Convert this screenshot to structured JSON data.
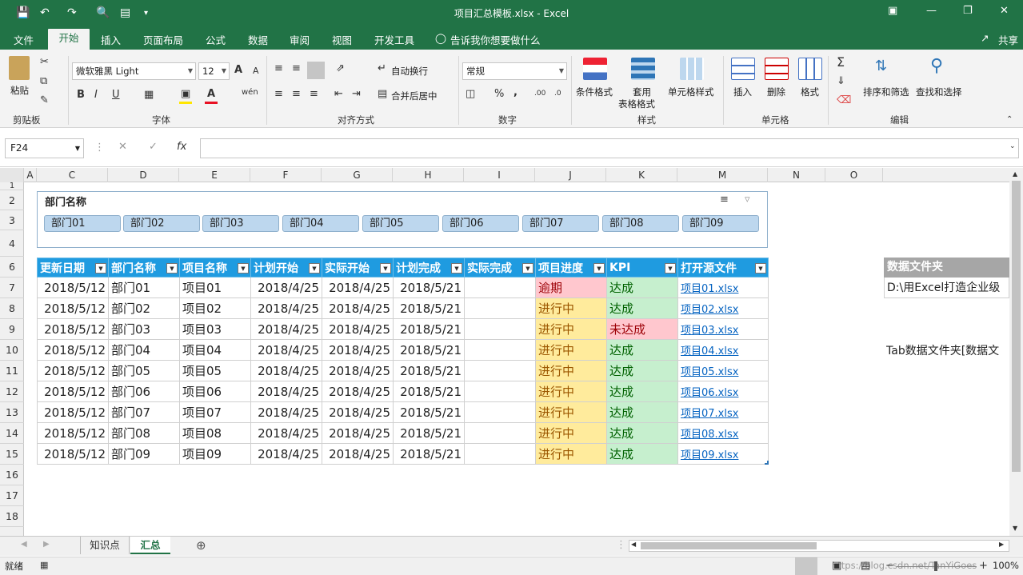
{
  "titlebar": {
    "doc_title": "项目汇总模板.xlsx  -  Excel",
    "save_icon": "save-icon",
    "undo_icon": "undo-icon",
    "redo_icon": "redo-icon",
    "preview_icon": "print-preview-icon",
    "form_icon": "form-icon"
  },
  "menu": {
    "items": [
      "文件",
      "开始",
      "插入",
      "页面布局",
      "公式",
      "数据",
      "审阅",
      "视图",
      "开发工具"
    ],
    "tellme": "告诉我你想要做什么",
    "share": "共享"
  },
  "ribbon": {
    "clipboard": {
      "paste": "粘贴",
      "group": "剪贴板"
    },
    "font": {
      "name": "微软雅黑 Light",
      "size": "12",
      "group": "字体",
      "bold": "B",
      "italic": "I",
      "underline": "U",
      "grow": "A",
      "shrink": "A",
      "fill_color": "#ffe600",
      "font_color": "#e81123"
    },
    "alignment": {
      "wrap": "自动换行",
      "merge": "合并后居中",
      "group": "对齐方式"
    },
    "number": {
      "format": "常规",
      "group": "数字",
      "percent": "%",
      "comma": ","
    },
    "styles": {
      "cond": "条件格式",
      "table_line1": "套用",
      "table_line2": "表格格式",
      "cell": "单元格样式",
      "group": "样式"
    },
    "cells": {
      "insert": "插入",
      "delete": "删除",
      "format": "格式",
      "group": "单元格"
    },
    "editing": {
      "sort": "排序和筛选",
      "find": "查找和选择",
      "group": "编辑",
      "sigma": "Σ"
    }
  },
  "formula_bar": {
    "name_box": "F24",
    "fx": "fx",
    "value": ""
  },
  "columns": [
    "A",
    "C",
    "D",
    "E",
    "F",
    "G",
    "H",
    "I",
    "J",
    "K",
    "M",
    "N",
    "O"
  ],
  "rows": [
    "1",
    "2",
    "3",
    "4",
    "6",
    "7",
    "8",
    "9",
    "10",
    "11",
    "12",
    "13",
    "14",
    "15",
    "16",
    "17",
    "18"
  ],
  "slicer": {
    "title": "部门名称",
    "items": [
      "部门01",
      "部门02",
      "部门03",
      "部门04",
      "部门05",
      "部门06",
      "部门07",
      "部门08",
      "部门09"
    ]
  },
  "table": {
    "headers": [
      "更新日期",
      "部门名称",
      "项目名称",
      "计划开始",
      "实际开始",
      "计划完成",
      "实际完成",
      "项目进度",
      "KPI",
      "打开源文件"
    ],
    "rows": [
      [
        "2018/5/12",
        "部门01",
        "项目01",
        "2018/4/25",
        "2018/4/25",
        "2018/5/21",
        "",
        "逾期",
        "达成",
        "项目01.xlsx"
      ],
      [
        "2018/5/12",
        "部门02",
        "项目02",
        "2018/4/25",
        "2018/4/25",
        "2018/5/21",
        "",
        "进行中",
        "达成",
        "项目02.xlsx"
      ],
      [
        "2018/5/12",
        "部门03",
        "项目03",
        "2018/4/25",
        "2018/4/25",
        "2018/5/21",
        "",
        "进行中",
        "未达成",
        "项目03.xlsx"
      ],
      [
        "2018/5/12",
        "部门04",
        "项目04",
        "2018/4/25",
        "2018/4/25",
        "2018/5/21",
        "",
        "进行中",
        "达成",
        "项目04.xlsx"
      ],
      [
        "2018/5/12",
        "部门05",
        "项目05",
        "2018/4/25",
        "2018/4/25",
        "2018/5/21",
        "",
        "进行中",
        "达成",
        "项目05.xlsx"
      ],
      [
        "2018/5/12",
        "部门06",
        "项目06",
        "2018/4/25",
        "2018/4/25",
        "2018/5/21",
        "",
        "进行中",
        "达成",
        "项目06.xlsx"
      ],
      [
        "2018/5/12",
        "部门07",
        "项目07",
        "2018/4/25",
        "2018/4/25",
        "2018/5/21",
        "",
        "进行中",
        "达成",
        "项目07.xlsx"
      ],
      [
        "2018/5/12",
        "部门08",
        "项目08",
        "2018/4/25",
        "2018/4/25",
        "2018/5/21",
        "",
        "进行中",
        "达成",
        "项目08.xlsx"
      ],
      [
        "2018/5/12",
        "部门09",
        "项目09",
        "2018/4/25",
        "2018/4/25",
        "2018/5/21",
        "",
        "进行中",
        "达成",
        "项目09.xlsx"
      ]
    ]
  },
  "side": {
    "header": "数据文件夹",
    "value": "D:\\用Excel打造企业级",
    "note": "Tab数据文件夹[数据文"
  },
  "sheets": {
    "tabs": [
      "知识点",
      "汇总"
    ],
    "active": "汇总"
  },
  "status": {
    "ready": "就绪",
    "zoom": "100%",
    "watermark": "https://blog.csdn.net/TanYiGoes"
  }
}
